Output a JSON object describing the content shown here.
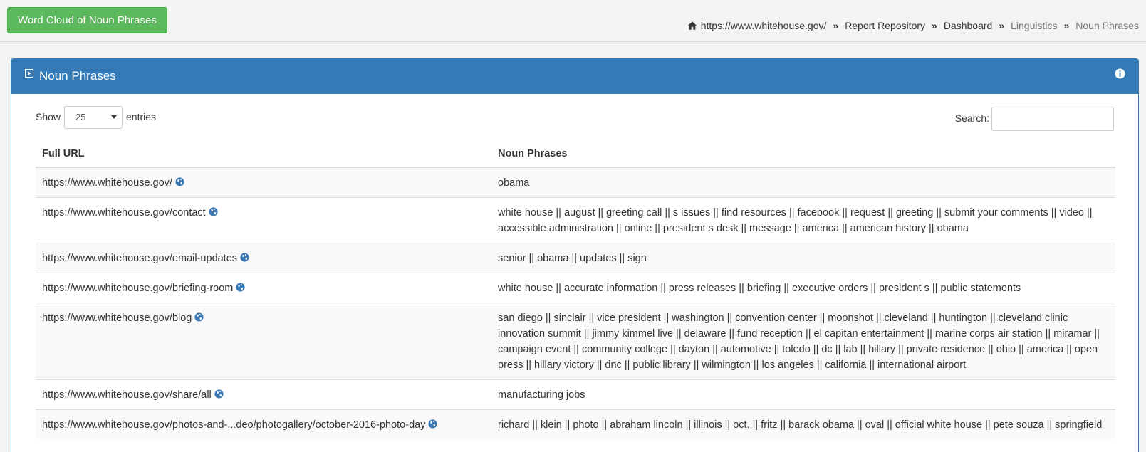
{
  "header": {
    "word_cloud_button": "Word Cloud of Noun Phrases",
    "breadcrumb": [
      {
        "label": "https://www.whitehouse.gov/",
        "muted": false
      },
      {
        "label": "Report Repository",
        "muted": false
      },
      {
        "label": "Dashboard",
        "muted": false
      },
      {
        "label": "Linguistics",
        "muted": true
      },
      {
        "label": "Noun Phrases",
        "muted": true
      }
    ],
    "breadcrumb_separator": "»"
  },
  "panel": {
    "title": "Noun Phrases",
    "show_label": "Show",
    "page_length": "25",
    "entries_label": "entries",
    "search_label": "Search:",
    "search_value": ""
  },
  "table": {
    "columns": [
      "Full URL",
      "Noun Phrases"
    ],
    "rows": [
      {
        "url": "https://www.whitehouse.gov/",
        "phrases": "obama"
      },
      {
        "url": "https://www.whitehouse.gov/contact",
        "phrases": "white house || august || greeting call || s issues || find resources || facebook || request || greeting || submit your comments || video || accessible administration || online || president s desk || message || america || american history || obama"
      },
      {
        "url": "https://www.whitehouse.gov/email-updates",
        "phrases": "senior || obama || updates || sign"
      },
      {
        "url": "https://www.whitehouse.gov/briefing-room",
        "phrases": "white house || accurate information || press releases || briefing || executive orders || president s || public statements"
      },
      {
        "url": "https://www.whitehouse.gov/blog",
        "phrases": "san diego || sinclair || vice president || washington || convention center || moonshot || cleveland || huntington || cleveland clinic innovation summit || jimmy kimmel live || delaware || fund reception || el capitan entertainment || marine corps air station || miramar || campaign event || community college || dayton || automotive || toledo || dc || lab || hillary || private residence || ohio || america || open press || hillary victory || dnc || public library || wilmington || los angeles || california || international airport"
      },
      {
        "url": "https://www.whitehouse.gov/share/all",
        "phrases": "manufacturing jobs"
      },
      {
        "url": "https://www.whitehouse.gov/photos-and-...deo/photogallery/october-2016-photo-day",
        "phrases": "richard || klein || photo || abraham lincoln || illinois || oct. || fritz || barack obama || oval || official white house || pete souza || springfield"
      }
    ]
  },
  "colors": {
    "accent": "#337ab7",
    "button_green": "#5cb85c",
    "globe_icon": "#3a78b5"
  }
}
